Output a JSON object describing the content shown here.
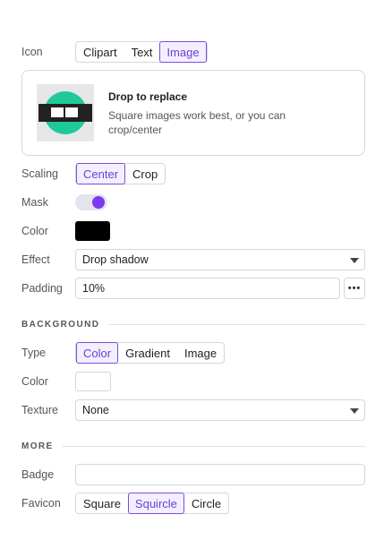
{
  "icon": {
    "label": "Icon",
    "options": [
      "Clipart",
      "Text",
      "Image"
    ],
    "selected": "Image"
  },
  "dropzone": {
    "title": "Drop to replace",
    "subtitle": "Square images work best, or you can crop/center"
  },
  "scaling": {
    "label": "Scaling",
    "options": [
      "Center",
      "Crop"
    ],
    "selected": "Center"
  },
  "mask": {
    "label": "Mask",
    "on": true
  },
  "color": {
    "label": "Color",
    "value": "#000000"
  },
  "effect": {
    "label": "Effect",
    "value": "Drop shadow"
  },
  "padding": {
    "label": "Padding",
    "value": "10%",
    "more": "•••"
  },
  "background": {
    "title": "BACKGROUND",
    "type": {
      "label": "Type",
      "options": [
        "Color",
        "Gradient",
        "Image"
      ],
      "selected": "Color"
    },
    "color": {
      "label": "Color",
      "value": "#ffffff"
    },
    "texture": {
      "label": "Texture",
      "value": "None"
    }
  },
  "more": {
    "title": "MORE",
    "badge": {
      "label": "Badge",
      "value": ""
    },
    "favicon": {
      "label": "Favicon",
      "options": [
        "Square",
        "Squircle",
        "Circle"
      ],
      "selected": "Squircle"
    }
  },
  "colors": {
    "accent": "#7c4ddb",
    "knob": "#7c3aed",
    "thumb_green": "#1fc99a"
  }
}
